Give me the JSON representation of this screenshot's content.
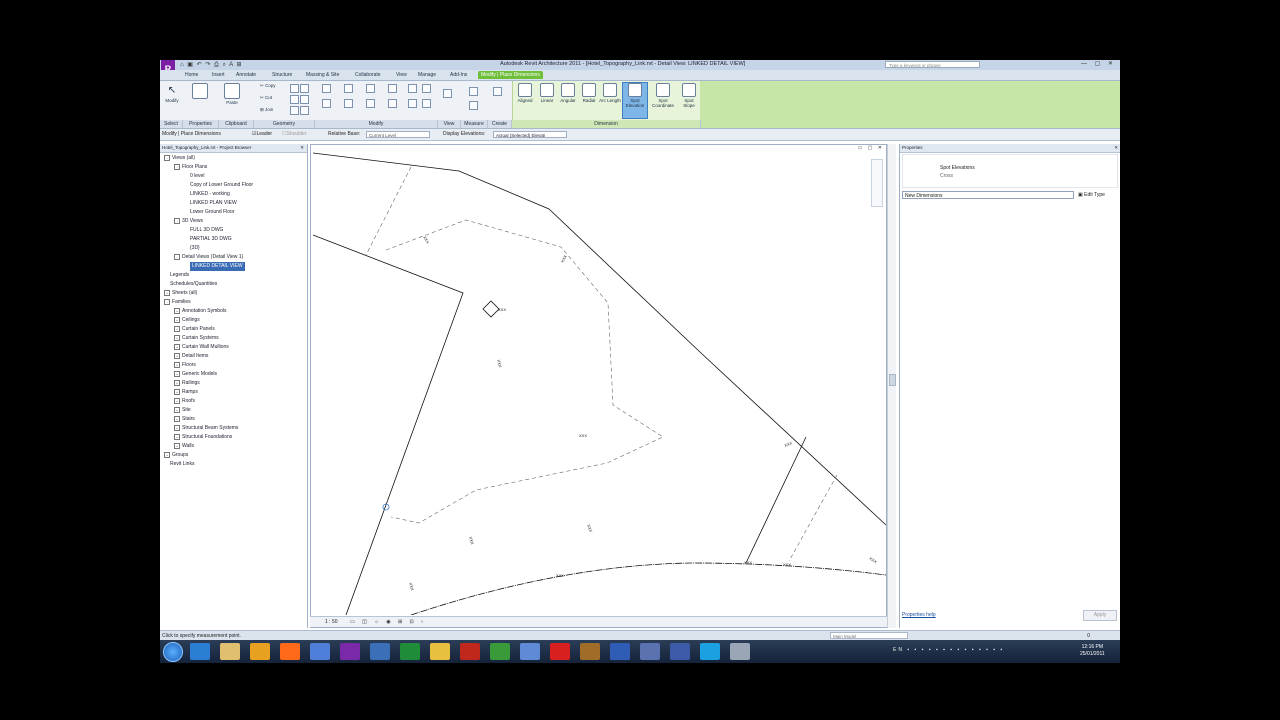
{
  "window": {
    "title": "Autodesk Revit Architecture 2011 - [Hotel_Topography_Link.rvt - Detail View: LINKED DETAIL VIEW]",
    "search_placeholder": "Type a keyword or phrase",
    "app_button": "R"
  },
  "tabs": [
    "Home",
    "Insert",
    "Annotate",
    "Structure",
    "Massing & Site",
    "Collaborate",
    "View",
    "Manage",
    "Add-Ins",
    "Modify | Place Dimensions"
  ],
  "active_tab": "Modify | Place Dimensions",
  "ribbon": {
    "panels": [
      "Select",
      "Properties",
      "Clipboard",
      "Geometry",
      "Modify",
      "View",
      "Measure",
      "Create",
      "Dimension"
    ],
    "buttons": {
      "modify": "Modify",
      "paste": "Paste",
      "copy": "Copy",
      "cut": "Cut",
      "join": "Join",
      "aligned": "Aligned",
      "linear": "Linear",
      "angular": "Angular",
      "radial": "Radial",
      "arc_length": "Arc Length",
      "spot_elevation": "Spot Elevation",
      "spot_coordinate": "Spot Coordinate",
      "spot_slope": "Spot Slope"
    }
  },
  "options_bar": {
    "context": "Modify | Place Dimensions",
    "leader": "Leader",
    "shoulder": "Shoulder",
    "relative_base_label": "Relative Base:",
    "relative_base_value": "Current Level",
    "display_elevations_label": "Display Elevations:",
    "display_elevations_value": "Actual (Selected) Elevati"
  },
  "project_browser": {
    "title": "Hotel_Topography_Link.rvt - Project Browser",
    "items": [
      {
        "label": "Views (all)",
        "depth": 0,
        "toggle": "-"
      },
      {
        "label": "Floor Plans",
        "depth": 1,
        "toggle": "-"
      },
      {
        "label": "0 level",
        "depth": 2
      },
      {
        "label": "Copy of Lower Ground Floor",
        "depth": 2
      },
      {
        "label": "LINKED - working",
        "depth": 2
      },
      {
        "label": "LINKED PLAN VIEW",
        "depth": 2
      },
      {
        "label": "Lower Ground Floor",
        "depth": 2
      },
      {
        "label": "3D Views",
        "depth": 1,
        "toggle": "-"
      },
      {
        "label": "FULL 3D DWG",
        "depth": 2
      },
      {
        "label": "PARTIAL 3D DWG",
        "depth": 2
      },
      {
        "label": "{3D}",
        "depth": 2
      },
      {
        "label": "Detail Views (Detail View 1)",
        "depth": 1,
        "toggle": "-"
      },
      {
        "label": "LINKED DETAIL VIEW",
        "depth": 2,
        "selected": true
      },
      {
        "label": "Legends",
        "depth": 0
      },
      {
        "label": "Schedules/Quantities",
        "depth": 0
      },
      {
        "label": "Sheets (all)",
        "depth": 0,
        "toggle": "+"
      },
      {
        "label": "Families",
        "depth": 0,
        "toggle": "-"
      },
      {
        "label": "Annotation Symbols",
        "depth": 1,
        "toggle": "+"
      },
      {
        "label": "Ceilings",
        "depth": 1,
        "toggle": "+"
      },
      {
        "label": "Curtain Panels",
        "depth": 1,
        "toggle": "+"
      },
      {
        "label": "Curtain Systems",
        "depth": 1,
        "toggle": "+"
      },
      {
        "label": "Curtain Wall Mullions",
        "depth": 1,
        "toggle": "+"
      },
      {
        "label": "Detail Items",
        "depth": 1,
        "toggle": "+"
      },
      {
        "label": "Floors",
        "depth": 1,
        "toggle": "+"
      },
      {
        "label": "Generic Models",
        "depth": 1,
        "toggle": "+"
      },
      {
        "label": "Railings",
        "depth": 1,
        "toggle": "+"
      },
      {
        "label": "Ramps",
        "depth": 1,
        "toggle": "+"
      },
      {
        "label": "Roofs",
        "depth": 1,
        "toggle": "+"
      },
      {
        "label": "Site",
        "depth": 1,
        "toggle": "+"
      },
      {
        "label": "Stairs",
        "depth": 1,
        "toggle": "+"
      },
      {
        "label": "Structural Beam Systems",
        "depth": 1,
        "toggle": "+"
      },
      {
        "label": "Structural Foundations",
        "depth": 1,
        "toggle": "+"
      },
      {
        "label": "Walls",
        "depth": 1,
        "toggle": "+"
      },
      {
        "label": "Groups",
        "depth": 0,
        "toggle": "+"
      },
      {
        "label": "Revit Links",
        "depth": 0
      }
    ]
  },
  "drawing": {
    "scale": "1 : 50",
    "spot_labels": [
      "XXX",
      "XXX",
      "XXX",
      "XXX",
      "XXX",
      "XXX",
      "XXX",
      "XXX",
      "XXX",
      "XXX",
      "XXX",
      "XXX"
    ]
  },
  "properties": {
    "title": "Properties",
    "type_line1": "Spot Elevations",
    "type_line2": "Cross",
    "selector": "New Dimensions",
    "edit_type": "Edit Type",
    "help_link": "Properties help",
    "apply": "Apply"
  },
  "status": {
    "text": "Click to specify measurement point.",
    "model": "Main Model",
    "filter": "0"
  },
  "taskbar": {
    "lang": "EN",
    "time": "12:16 PM",
    "date": "25/01/2011",
    "apps": [
      "ie-icon",
      "explorer-icon",
      "media-icon",
      "firefox-icon",
      "paint-icon",
      "revit-icon",
      "3d-icon",
      "excel-icon",
      "folder-icon",
      "acrobat-icon",
      "chart-icon",
      "doc-icon",
      "autocad-icon",
      "archicad-icon",
      "word-icon",
      "network-icon",
      "photoshop-icon",
      "skype-icon",
      "window-icon"
    ],
    "app_colors": [
      "#2a7fd4",
      "#e0c070",
      "#e8a020",
      "#ff6a1a",
      "#4f7fd9",
      "#7a2aa8",
      "#3b6fb8",
      "#1f8c3a",
      "#e8c040",
      "#c0281e",
      "#3a9a3a",
      "#5f8ad6",
      "#d92020",
      "#a06c2a",
      "#2f5db5",
      "#5a72b0",
      "#3c5aa8",
      "#1ba0e1",
      "#9aa6b6"
    ]
  }
}
